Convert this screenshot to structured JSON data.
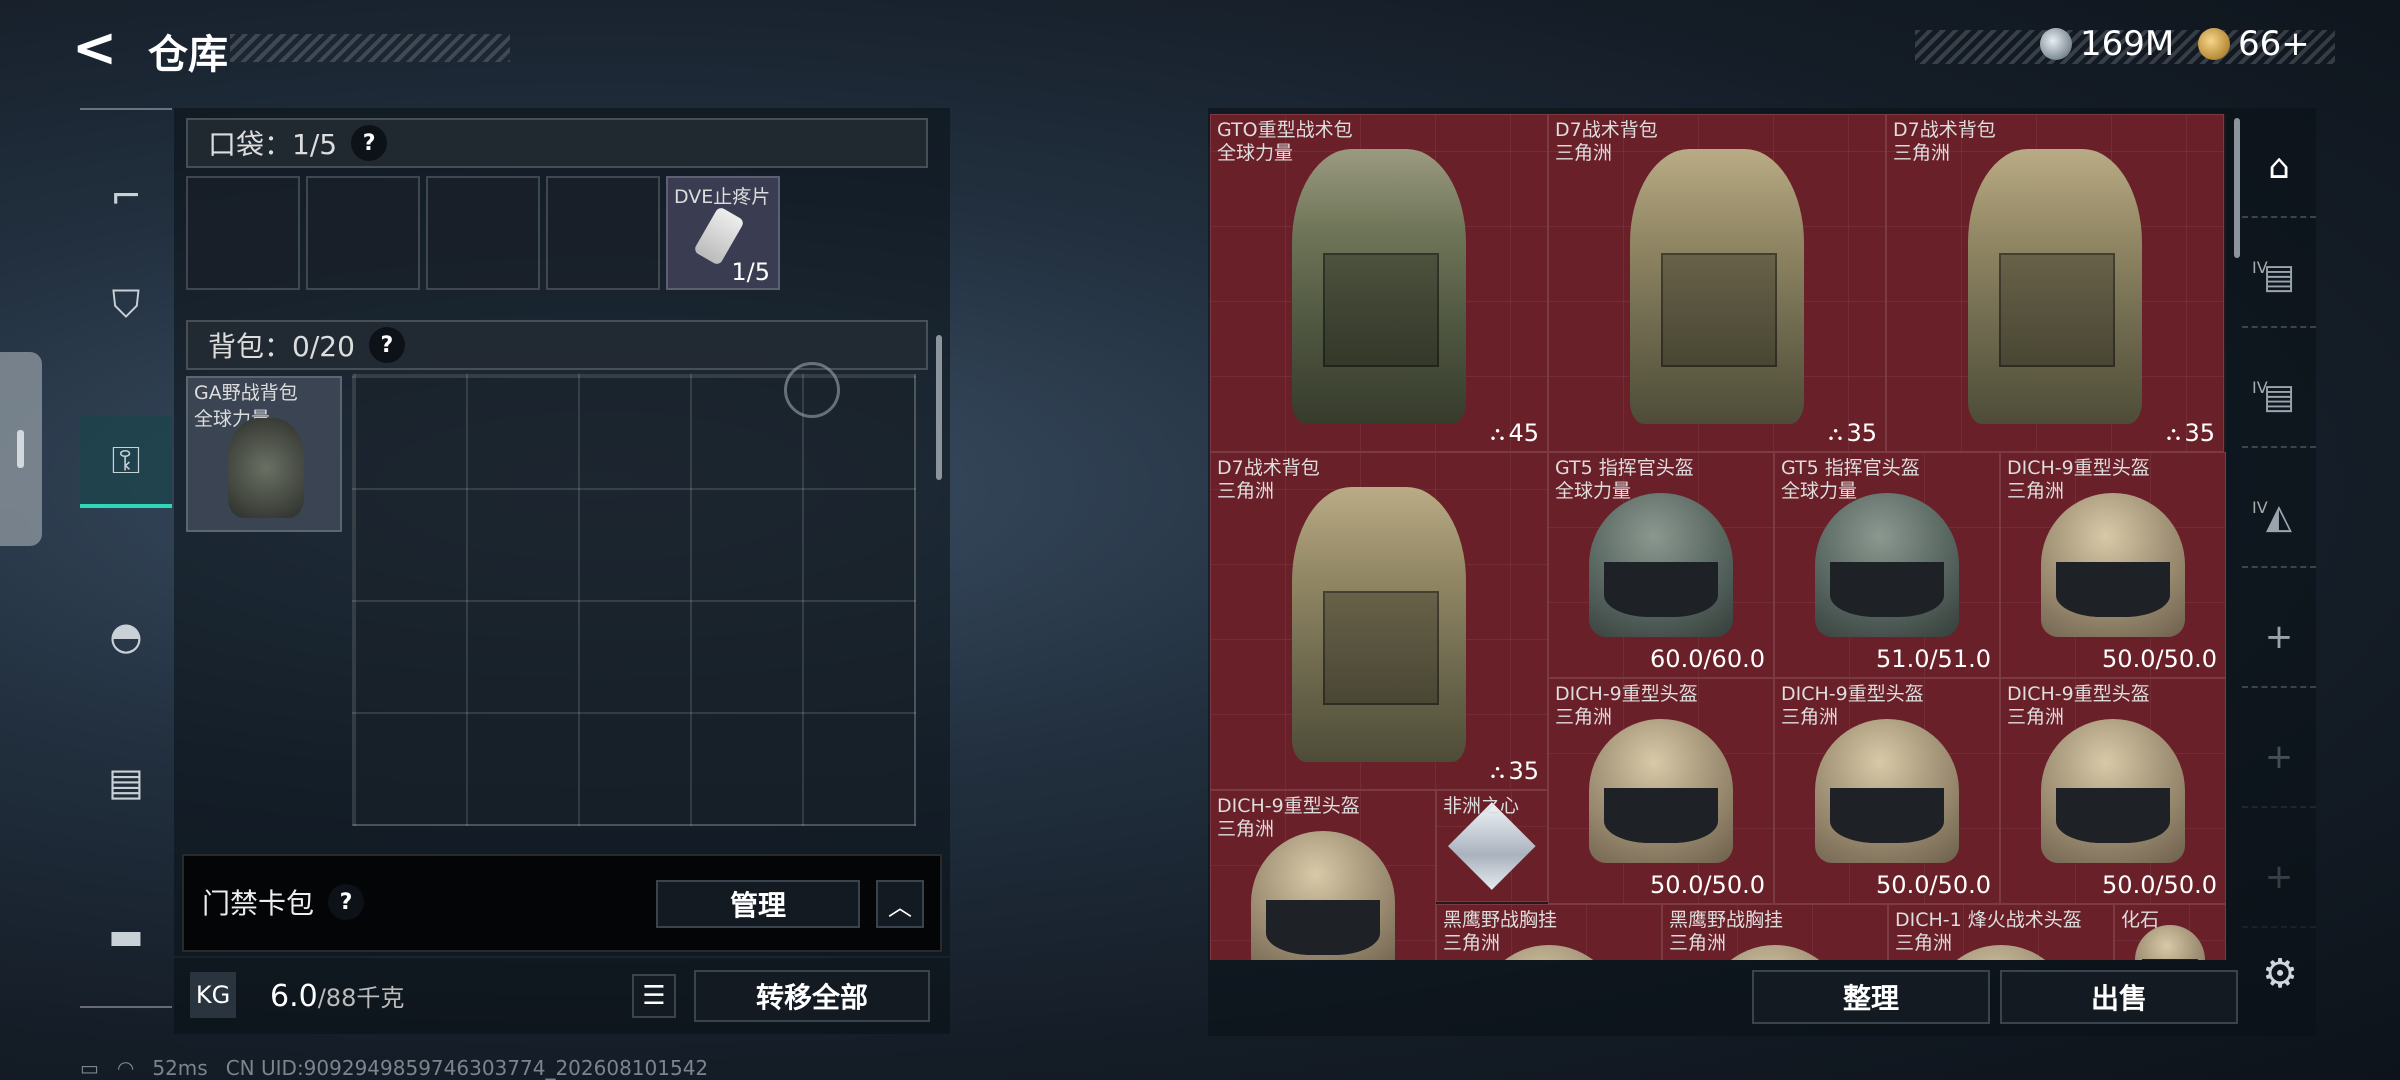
{
  "header": {
    "title": "仓库",
    "currency": [
      {
        "icon": "silver-coin-icon",
        "value": "169M"
      },
      {
        "icon": "gold-coin-icon",
        "value": "66+"
      }
    ]
  },
  "pocket": {
    "label": "口袋：1/5",
    "help": "?",
    "item": {
      "name": "DVE止疼片",
      "count": "1/5"
    }
  },
  "backpack": {
    "label": "背包：0/20",
    "help": "?",
    "item": {
      "name": "GA野战背包",
      "tag": "全球力量"
    }
  },
  "keycard": {
    "label": "门禁卡包",
    "help": "?",
    "manage": "管理"
  },
  "footer": {
    "weight": "6.0",
    "weight_unit": "/88千克",
    "weight_icon": "KG",
    "transfer": "转移全部"
  },
  "status": {
    "ping": "52ms",
    "uid": "CN UID:9092949859746303774_202608101542"
  },
  "stash": {
    "items": [
      {
        "name": "GTO重型战术包",
        "tag": "全球力量",
        "value": "45",
        "kind": "bag"
      },
      {
        "name": "D7战术背包",
        "tag": "三角洲",
        "value": "35",
        "kind": "bag"
      },
      {
        "name": "D7战术背包",
        "tag": "三角洲",
        "value": "35",
        "kind": "bag"
      },
      {
        "name": "D7战术背包",
        "tag": "三角洲",
        "value": "35",
        "kind": "bag"
      },
      {
        "name": "GT5 指挥官头盔",
        "tag": "全球力量",
        "value": "60.0/60.0",
        "kind": "helmet"
      },
      {
        "name": "GT5 指挥官头盔",
        "tag": "全球力量",
        "value": "51.0/51.0",
        "kind": "helmet"
      },
      {
        "name": "DICH-9重型头盔",
        "tag": "三角洲",
        "value": "50.0/50.0",
        "kind": "helmet"
      },
      {
        "name": "DICH-9重型头盔",
        "tag": "三角洲",
        "value": "50.0/50.0",
        "kind": "helmet"
      },
      {
        "name": "DICH-9重型头盔",
        "tag": "三角洲",
        "value": "50.0/50.0",
        "kind": "helmet"
      },
      {
        "name": "DICH-9重型头盔",
        "tag": "三角洲",
        "value": "50.0/50.0",
        "kind": "helmet"
      },
      {
        "name": "DICH-9重型头盔",
        "tag": "三角洲",
        "value": "",
        "kind": "helmet"
      },
      {
        "name": "非洲之心",
        "tag": "",
        "value": "",
        "kind": "gem"
      },
      {
        "name": "黑鹰野战胸挂",
        "tag": "三角洲",
        "value": "",
        "kind": "vest"
      },
      {
        "name": "黑鹰野战胸挂",
        "tag": "三角洲",
        "value": "",
        "kind": "vest"
      },
      {
        "name": "DICH-1 烽火战术头盔",
        "tag": "三角洲",
        "value": "",
        "kind": "helmet"
      },
      {
        "name": "化石",
        "tag": "",
        "value": "",
        "kind": "other"
      }
    ],
    "organize": "整理",
    "sell": "出售"
  },
  "rightnav": [
    {
      "tag": ""
    },
    {
      "tag": "IV"
    },
    {
      "tag": "IV"
    },
    {
      "tag": "IV"
    },
    {
      "tag": "+"
    },
    {
      "tag": "+"
    },
    {
      "tag": "+"
    }
  ],
  "icons": {
    "back": "back-arrow-icon",
    "weapon": "gun-icon",
    "armor": "vest-icon",
    "bag": "backpack-icon",
    "helmet": "helmet-icon",
    "chest": "chest-rig-icon",
    "case": "case-icon",
    "settings": "gear-icon"
  }
}
